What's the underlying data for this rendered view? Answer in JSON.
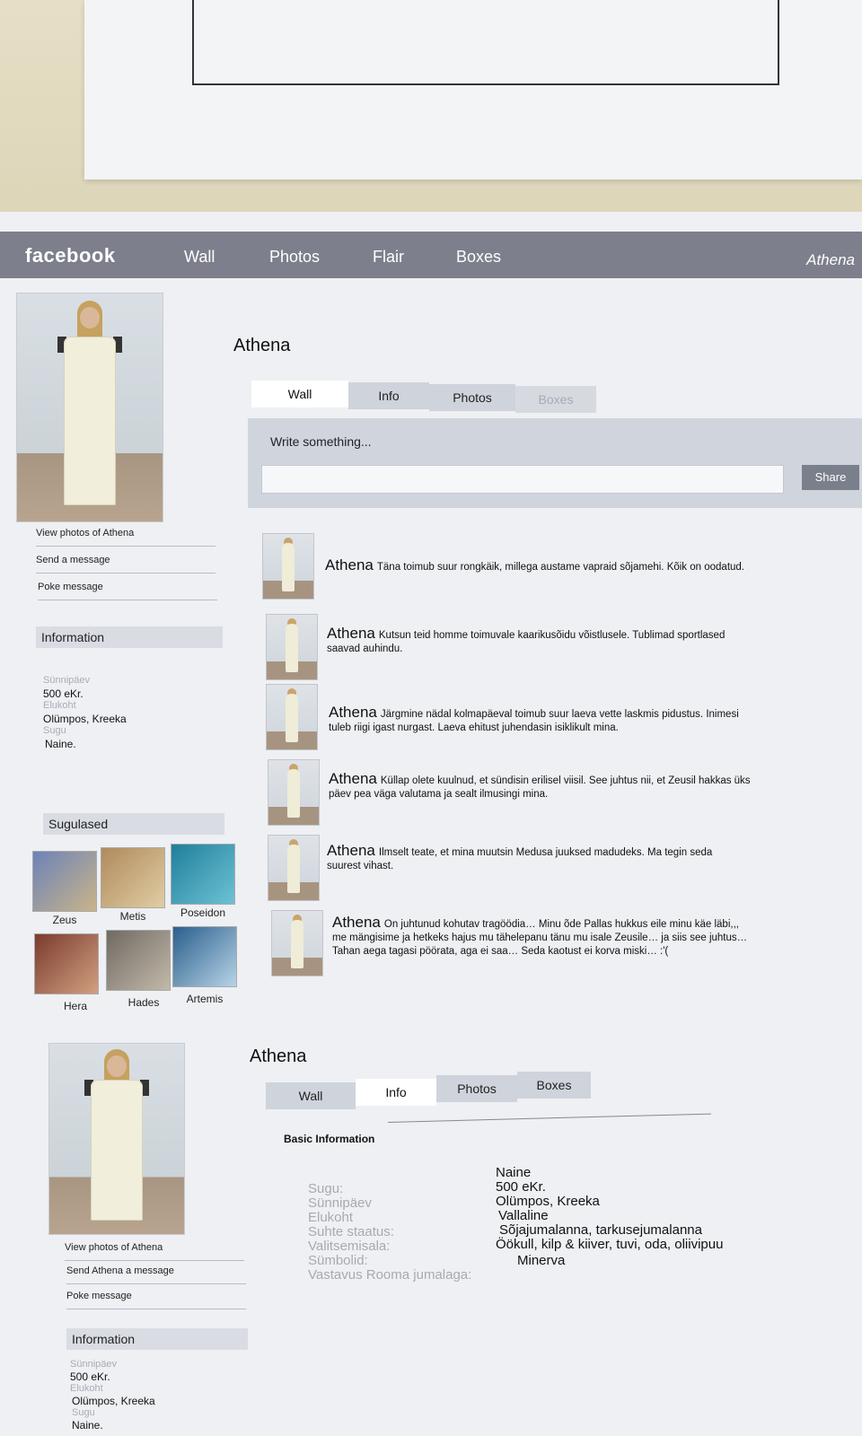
{
  "nav": {
    "logo": "facebook",
    "items": [
      "Wall",
      "Photos",
      "Flair",
      "Boxes"
    ],
    "user": "Athena"
  },
  "profile1": {
    "name": "Athena",
    "sidebar_links": [
      "View photos of Athena",
      "Send a message",
      "Poke message"
    ],
    "info_header": "Information",
    "info": [
      {
        "label": "Sünnipäev",
        "value": "500 eKr."
      },
      {
        "label": "Elukoht",
        "value": "Olümpos, Kreeka"
      },
      {
        "label": "Sugu",
        "value": "Naine."
      }
    ],
    "friends_header": "Sugulased",
    "friends": [
      "Zeus",
      "Metis",
      "Poseidon",
      "Hera",
      "Hades",
      "Artemis"
    ],
    "tabs": [
      "Wall",
      "Info",
      "Photos",
      "Boxes"
    ],
    "compose_label": "Write something...",
    "share_label": "Share",
    "posts": [
      {
        "author": "Athena",
        "text": "Täna toimub suur rongkäik, millega austame vapraid sõjamehi. Kõik on oodatud."
      },
      {
        "author": "Athena",
        "text": "Kutsun teid homme toimuvale kaarikusõidu võistlusele. Tublimad sportlased saavad auhindu."
      },
      {
        "author": "Athena",
        "text": "Järgmine nädal kolmapäeval toimub suur laeva vette laskmis pidustus. Inimesi tuleb riigi igast nurgast. Laeva ehitust juhendasin isiklikult mina."
      },
      {
        "author": "Athena",
        "text": "Küllap olete kuulnud, et sündisin erilisel viisil. See juhtus nii, et Zeusil hakkas üks päev pea väga valutama ja sealt ilmusingi mina."
      },
      {
        "author": "Athena",
        "text": "Ilmselt teate, et mina muutsin Medusa juuksed madudeks. Ma tegin seda suurest vihast."
      },
      {
        "author": "Athena",
        "text": "On juhtunud kohutav tragöödia… Minu õde Pallas hukkus eile minu käe läbi,,, me mängisime ja hetkeks hajus mu tähelepanu tänu mu isale Zeusile… ja siis see juhtus… Tahan aega tagasi pöörata, aga ei saa… Seda kaotust ei korva miski… :'("
      }
    ]
  },
  "profile2": {
    "name": "Athena",
    "tabs": [
      "Wall",
      "Info",
      "Photos",
      "Boxes"
    ],
    "sidebar_links": [
      "View photos of Athena",
      "Send Athena a message",
      "Poke message"
    ],
    "info_header": "Information",
    "info": [
      {
        "label": "Sünnipäev",
        "value": "500 eKr."
      },
      {
        "label": "Elukoht",
        "value": "Olümpos, Kreeka"
      },
      {
        "label": "Sugu",
        "value": "Naine."
      }
    ],
    "basic_info_title": "Basic Information",
    "basic_info": [
      {
        "label": "Sugu:",
        "value": "Naine"
      },
      {
        "label": "Sünnipäev",
        "value": "500  eKr."
      },
      {
        "label": "Elukoht",
        "value": "Olümpos, Kreeka"
      },
      {
        "label": "Suhte staatus:",
        "value": "Vallaline"
      },
      {
        "label": "Valitsemisala:",
        "value": "Sõjajumalanna, tarkusejumalanna"
      },
      {
        "label": "Sümbolid:",
        "value": "Öökull, kilp & kiiver, tuvi, oda, oliivipuu"
      },
      {
        "label": "Vastavus Rooma jumalaga:",
        "value": "Minerva"
      }
    ]
  },
  "colors": {
    "topbar": "#7d7f8c",
    "tab_inactive": "#cfd3db",
    "compose_bg": "#d0d5dd",
    "share_button": "#7a7f8c",
    "label_gray": "#a9acb4"
  },
  "icons": [
    "profile-photo",
    "post-avatar",
    "friend-photo"
  ]
}
